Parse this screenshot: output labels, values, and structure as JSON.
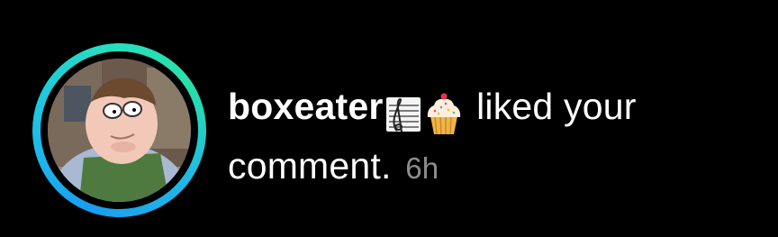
{
  "notification": {
    "username": "boxeater",
    "emojis": [
      "musical-score-icon",
      "cupcake-icon"
    ],
    "action_line1": "liked your",
    "action_line2": "comment.",
    "timestamp": "6h"
  },
  "colors": {
    "background": "#000000",
    "text": "#ffffff",
    "timestamp": "#8e8e8e",
    "ring_start": "#1a9df0",
    "ring_end": "#2be0a8"
  }
}
